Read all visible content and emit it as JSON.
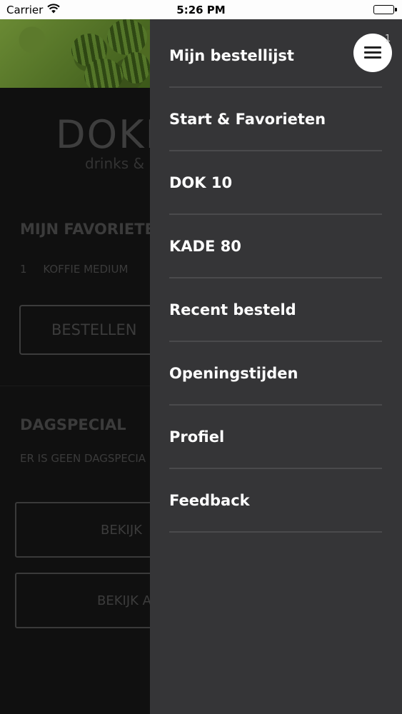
{
  "status_bar": {
    "carrier": "Carrier",
    "time": "5:26 PM"
  },
  "background": {
    "logo_main": "DOKI",
    "logo_sub": "drinks &",
    "favorites": {
      "title": "MIJN FAVORIETE",
      "items": [
        {
          "qty": "1",
          "name": "KOFFIE MEDIUM"
        }
      ],
      "order_button": "BESTELLEN"
    },
    "dagspecial": {
      "title": "DAGSPECIAL",
      "text": "ER IS GEEN DAGSPECIA",
      "view_button_1": "BEKIJK",
      "view_button_2": "BEKIJK A"
    }
  },
  "drawer": {
    "badge_count": "1",
    "menu_button_icon": "hamburger-icon",
    "items": [
      {
        "label": "Mijn bestellijst"
      },
      {
        "label": "Start & Favorieten"
      },
      {
        "label": "DOK 10"
      },
      {
        "label": "KADE 80"
      },
      {
        "label": "Recent besteld"
      },
      {
        "label": "Openingstijden"
      },
      {
        "label": "Profiel"
      },
      {
        "label": "Feedback"
      }
    ]
  },
  "colors": {
    "drawer_bg": "#353537",
    "divider": "#4a4a4c",
    "menu_text": "#ffffff",
    "dimmed_text": "#3b3b3b"
  }
}
